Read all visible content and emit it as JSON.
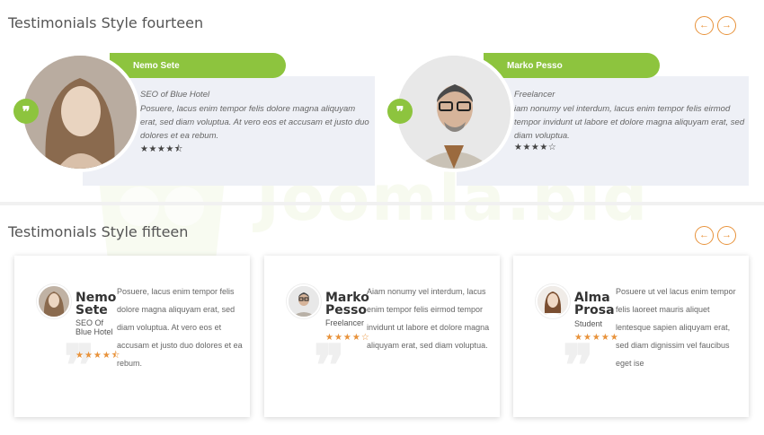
{
  "watermark": {
    "text": "Joomla.bid"
  },
  "fourteen": {
    "title": "Testimonials Style fourteen",
    "nav": {
      "prev": "←",
      "next": "→"
    },
    "items": [
      {
        "name": "Nemo Sete",
        "role": "SEO of Blue Hotel",
        "text": "Posuere, lacus enim tempor felis dolore magna aliquyam erat, sed diam voluptua. At vero eos et accusam et justo duo dolores et ea rebum.",
        "stars": "★★★★⯪",
        "rating": 4.5,
        "quote": "❞"
      },
      {
        "name": "Marko Pesso",
        "role": "Freelancer",
        "text": "iam nonumy vel interdum, lacus enim tempor felis eirmod tempor invidunt ut labore et dolore magna aliquyam erat, sed diam voluptua.",
        "stars": "★★★★☆",
        "rating": 4,
        "quote": "❞"
      }
    ]
  },
  "fifteen": {
    "title": "Testimonials Style fifteen",
    "nav": {
      "prev": "←",
      "next": "→"
    },
    "items": [
      {
        "name": "Nemo Sete",
        "role": "SEO Of Blue Hotel",
        "stars": "★★★★⯪",
        "rating": 4.5,
        "text": "Posuere, lacus enim tempor felis dolore magna aliquyam erat, sed diam voluptua. At vero eos et accusam et justo duo dolores et ea rebum.",
        "quote": "❞"
      },
      {
        "name": "Marko Pesso",
        "role": "Freelancer",
        "stars": "★★★★☆",
        "rating": 4,
        "text": "Aiam nonumy vel interdum, lacus enim tempor felis eirmod tempor invidunt ut labore et dolore magna aliquyam erat, sed diam voluptua.",
        "quote": "❞"
      },
      {
        "name": "Alma Prosa",
        "role": "Student",
        "stars": "★★★★★",
        "rating": 5,
        "text": "Posuere ut vel lacus enim tempor felis laoreet mauris aliquet lentesque sapien aliquyam erat, sed diam dignissim vel faucibus eget ise",
        "quote": "❞"
      }
    ]
  },
  "colors": {
    "accent_green": "#8dc43e",
    "accent_orange": "#e8923a",
    "panel_bg": "#eef0f6"
  }
}
